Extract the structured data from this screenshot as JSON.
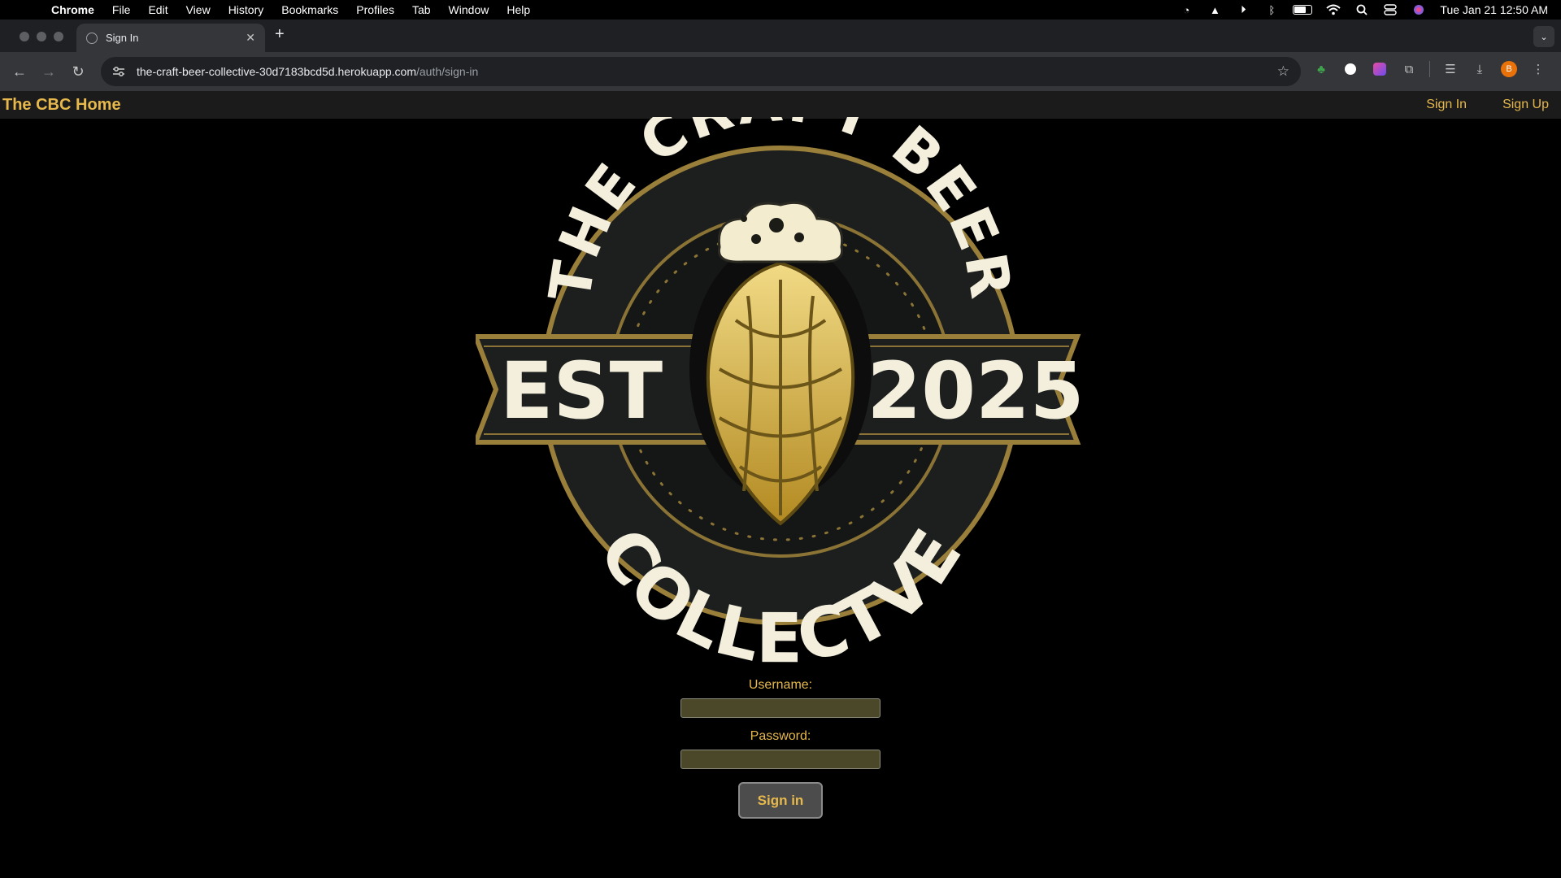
{
  "menubar": {
    "app": "Chrome",
    "items": [
      "File",
      "Edit",
      "View",
      "History",
      "Bookmarks",
      "Profiles",
      "Tab",
      "Window",
      "Help"
    ],
    "clock": "Tue Jan 21  12:50 AM"
  },
  "browser": {
    "tab_title": "Sign In",
    "url_host": "the-craft-beer-collective-30d7183bcd5d.herokuapp.com",
    "url_path": "/auth/sign-in",
    "profile_initial": "B"
  },
  "site": {
    "brand": "The CBC Home",
    "nav": {
      "sign_in": "Sign In",
      "sign_up": "Sign Up"
    },
    "accent_color": "#e7b94c"
  },
  "logo": {
    "top_text": "THE CRAFT BEER",
    "left_text": "EST",
    "right_text": "2025",
    "bottom_text": "COLLECTVE"
  },
  "form": {
    "username_label": "Username:",
    "username_value": "",
    "password_label": "Password:",
    "password_value": "",
    "submit_label": "Sign in"
  }
}
